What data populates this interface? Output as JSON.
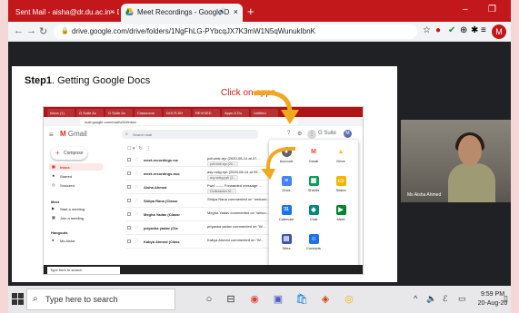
{
  "browser": {
    "tabs": [
      {
        "title": "Sent Mail - aisha@dr.du.ac.in - D",
        "active": false
      },
      {
        "title": "Meet Recordings - Google D",
        "active": true
      }
    ],
    "close_glyph": "×",
    "new_tab_glyph": "+",
    "window_controls": {
      "minimize": "–",
      "maximize": "❐"
    },
    "nav": {
      "back": "←",
      "forward": "→",
      "reload": "↻"
    },
    "url": "drive.google.com/drive/folders/1NgFhLG-PYbcqJX7K3mW1N5qWunukIbnK",
    "profile_initial": "M",
    "extension_icons": [
      {
        "name": "star-icon",
        "glyph": "☆",
        "color": "#5f6368"
      },
      {
        "name": "record-icon",
        "glyph": "●",
        "color": "#c2181b"
      },
      {
        "name": "check-icon",
        "glyph": "✔",
        "color": "#1e8e3e"
      },
      {
        "name": "extension-icon",
        "glyph": "⊕",
        "color": "#5f6368"
      },
      {
        "name": "puzzle-icon",
        "glyph": "✱",
        "color": "#5f6368"
      },
      {
        "name": "menu-icon",
        "glyph": "≡",
        "color": "#5f6368"
      }
    ]
  },
  "slide": {
    "title_bold": "Step1",
    "title_rest": ". Getting Google Docs",
    "callout": "Click on apps"
  },
  "inner": {
    "tab_labels": [
      "Inbox (1)",
      "G Suite Ac",
      "G Suite Ac",
      "Classroom",
      "DOCS.SH",
      "REVISED",
      "Apps & Do",
      "Untitled"
    ],
    "url": "mail.google.com/mail/u/0/#inbox",
    "gmail_label": "Gmail",
    "search_placeholder": "Search mail",
    "gsuite_label": "G Suite",
    "avatar_initial": "M",
    "compose": "Compose",
    "sidebar": [
      {
        "icon": "▣",
        "label": "Inbox",
        "selected": true
      },
      {
        "icon": "★",
        "label": "Starred",
        "selected": false
      },
      {
        "icon": "◷",
        "label": "Snoozed",
        "selected": false
      }
    ],
    "meet_heading": "Meet",
    "meet_items": [
      "Start a meeting",
      "Join a meeting"
    ],
    "hangouts_heading": "Hangouts",
    "hangout_user": "Ms Aisha",
    "rows": [
      {
        "sender": "meet.recordings me",
        "subject": "pdf-shdr-ejo (2020-08-14 at 07...",
        "chip": "pdf-shdr-ejo (20..."
      },
      {
        "sender": "meet-recordings-noc",
        "subject": "asy-rudg-ryb (2020-08-14 at 09...",
        "chip": "auy-wdrg-pyh (2..."
      },
      {
        "sender": "Aisha Ahmed",
        "subject": "Fwd: ------ Forwarded message ...",
        "chip": "Contrasmen M..."
      },
      {
        "sender": "Shilpa Rana (Classr",
        "subject": "Shilpa Rana commented on \"welcom...",
        "chip": ""
      },
      {
        "sender": "Megha Yadav (Classr",
        "subject": "Megha Yadav commented on \"welco...",
        "chip": ""
      },
      {
        "sender": "priyanka yadav (Cla",
        "subject": "priyanka yadav commented on \"W...",
        "chip": ""
      },
      {
        "sender": "Kabya Ahmed (Class",
        "subject": "Kabya Ahmed commented on \"W...",
        "chip": ""
      }
    ],
    "apps": [
      {
        "name": "Account",
        "glyph": "●",
        "color": "#5f6368"
      },
      {
        "name": "Gmail",
        "glyph": "M",
        "color": "#ea4335"
      },
      {
        "name": "Drive",
        "glyph": "▲",
        "color": "#fbbc04"
      },
      {
        "name": "Docs",
        "glyph": "≡",
        "color": "#4285f4"
      },
      {
        "name": "Sheets",
        "glyph": "▦",
        "color": "#0f9d58"
      },
      {
        "name": "Slides",
        "glyph": "▭",
        "color": "#f4b400"
      },
      {
        "name": "Calendar",
        "glyph": "31",
        "color": "#1a73e8"
      },
      {
        "name": "Chat",
        "glyph": "◆",
        "color": "#00897b"
      },
      {
        "name": "Meet",
        "glyph": "▶",
        "color": "#00832d"
      },
      {
        "name": "Sites",
        "glyph": "▤",
        "color": "#3f51b5"
      },
      {
        "name": "Contacts",
        "glyph": "☺",
        "color": "#1a73e8"
      }
    ],
    "taskbar_search": "Type here to search",
    "status_url": "https://mail.google.com/mail/u/0/#inbox"
  },
  "camera": {
    "name_label": "Ms Aisha Ahmed"
  },
  "taskbar": {
    "search_placeholder": "Type here to search",
    "apps": [
      {
        "name": "task-view-icon",
        "glyph": "⊟",
        "color": "#333"
      },
      {
        "name": "chrome-icon",
        "glyph": "◉",
        "color": "#db4437"
      },
      {
        "name": "teams-icon",
        "glyph": "▣",
        "color": "#5059c9"
      },
      {
        "name": "store-icon",
        "glyph": "🛍",
        "color": "#0078d4"
      },
      {
        "name": "office-icon",
        "glyph": "◈",
        "color": "#d83b01"
      },
      {
        "name": "chrome-canary-icon",
        "glyph": "◎",
        "color": "#f4b400"
      }
    ],
    "tray": [
      "^",
      "🔈",
      "ℰ",
      "▭"
    ],
    "time": "9:59 PM",
    "date": "20-Aug-20",
    "notification_glyph": "▯"
  }
}
